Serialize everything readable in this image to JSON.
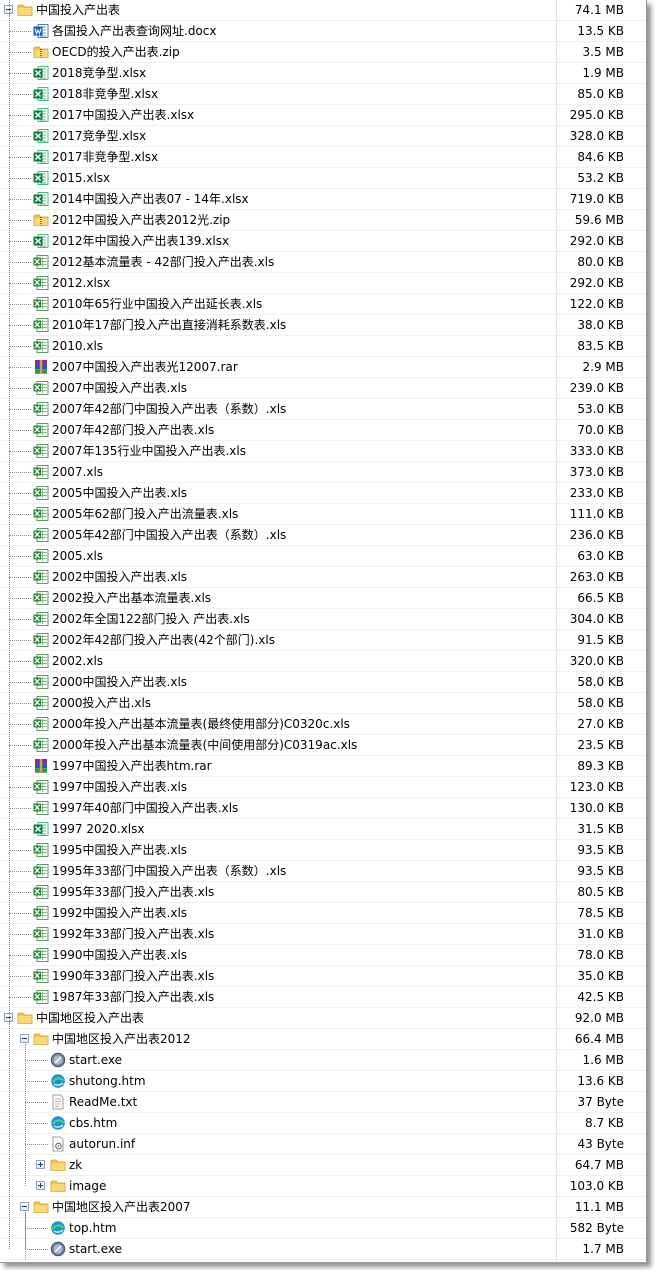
{
  "rows": [
    {
      "name": "中国投入产出表",
      "size": "74.1 MB",
      "type": "folder",
      "level": 0,
      "toggle": "minus"
    },
    {
      "name": "各国投入产出表查询网址.docx",
      "size": "13.5 KB",
      "type": "docx-icon",
      "level": 1
    },
    {
      "name": "OECD的投入产出表.zip",
      "size": "3.5 MB",
      "type": "zip-icon",
      "level": 1
    },
    {
      "name": "2018竞争型.xlsx",
      "size": "1.9 MB",
      "type": "xlsx-icon",
      "level": 1
    },
    {
      "name": "2018非竞争型.xlsx",
      "size": "85.0 KB",
      "type": "xlsx-icon",
      "level": 1
    },
    {
      "name": "2017中国投入产出表.xlsx",
      "size": "295.0 KB",
      "type": "xlsx-icon",
      "level": 1
    },
    {
      "name": "2017竞争型.xlsx",
      "size": "328.0 KB",
      "type": "xlsx-icon",
      "level": 1
    },
    {
      "name": "2017非竞争型.xlsx",
      "size": "84.6 KB",
      "type": "xlsx-icon",
      "level": 1
    },
    {
      "name": "2015.xlsx",
      "size": "53.2 KB",
      "type": "xlsx-icon",
      "level": 1
    },
    {
      "name": "2014中国投入产出表07 - 14年.xlsx",
      "size": "719.0 KB",
      "type": "xlsx-icon",
      "level": 1
    },
    {
      "name": "2012中国投入产出表2012光.zip",
      "size": "59.6 MB",
      "type": "zip-icon",
      "level": 1
    },
    {
      "name": "2012年中国投入产出表139.xlsx",
      "size": "292.0 KB",
      "type": "xlsx-icon",
      "level": 1
    },
    {
      "name": "2012基本流量表 - 42部门投入产出表.xls",
      "size": "80.0 KB",
      "type": "xls-icon",
      "level": 1
    },
    {
      "name": "2012.xlsx",
      "size": "292.0 KB",
      "type": "xls-icon",
      "level": 1
    },
    {
      "name": "2010年65行业中国投入产出延长表.xls",
      "size": "122.0 KB",
      "type": "xls-icon",
      "level": 1
    },
    {
      "name": "2010年17部门投入产出直接消耗系数表.xls",
      "size": "38.0 KB",
      "type": "xls-icon",
      "level": 1
    },
    {
      "name": "2010.xls",
      "size": "83.5 KB",
      "type": "xls-icon",
      "level": 1
    },
    {
      "name": "2007中国投入产出表光12007.rar",
      "size": "2.9 MB",
      "type": "rar-icon",
      "level": 1
    },
    {
      "name": "2007中国投入产出表.xls",
      "size": "239.0 KB",
      "type": "xls-icon",
      "level": 1
    },
    {
      "name": "2007年42部门中国投入产出表（系数）.xls",
      "size": "53.0 KB",
      "type": "xls-icon",
      "level": 1
    },
    {
      "name": "2007年42部门投入产出表.xls",
      "size": "70.0 KB",
      "type": "xls-icon",
      "level": 1
    },
    {
      "name": "2007年135行业中国投入产出表.xls",
      "size": "333.0 KB",
      "type": "xls-icon",
      "level": 1
    },
    {
      "name": "2007.xls",
      "size": "373.0 KB",
      "type": "xls-icon",
      "level": 1
    },
    {
      "name": "2005中国投入产出表.xls",
      "size": "233.0 KB",
      "type": "xls-icon",
      "level": 1
    },
    {
      "name": "2005年62部门投入产出流量表.xls",
      "size": "111.0 KB",
      "type": "xls-icon",
      "level": 1
    },
    {
      "name": "2005年42部门中国投入产出表（系数）.xls",
      "size": "236.0 KB",
      "type": "xls-icon",
      "level": 1
    },
    {
      "name": "2005.xls",
      "size": "63.0 KB",
      "type": "xls-icon",
      "level": 1
    },
    {
      "name": "2002中国投入产出表.xls",
      "size": "263.0 KB",
      "type": "xls-icon",
      "level": 1
    },
    {
      "name": "2002投入产出基本流量表.xls",
      "size": "66.5 KB",
      "type": "xls-icon",
      "level": 1
    },
    {
      "name": "2002年全国122部门投入 产出表.xls",
      "size": "304.0 KB",
      "type": "xls-icon",
      "level": 1
    },
    {
      "name": "2002年42部门投入产出表(42个部门).xls",
      "size": "91.5 KB",
      "type": "xls-icon",
      "level": 1
    },
    {
      "name": "2002.xls",
      "size": "320.0 KB",
      "type": "xls-icon",
      "level": 1
    },
    {
      "name": "2000中国投入产出表.xls",
      "size": "58.0 KB",
      "type": "xls-icon",
      "level": 1
    },
    {
      "name": "2000投入产出.xls",
      "size": "58.0 KB",
      "type": "xls-icon",
      "level": 1
    },
    {
      "name": "2000年投入产出基本流量表(最终使用部分)C0320c.xls",
      "size": "27.0 KB",
      "type": "xls-icon",
      "level": 1
    },
    {
      "name": "2000年投入产出基本流量表(中间使用部分)C0319ac.xls",
      "size": "23.5 KB",
      "type": "xls-icon",
      "level": 1
    },
    {
      "name": "1997中国投入产出表htm.rar",
      "size": "89.3 KB",
      "type": "rar-icon",
      "level": 1
    },
    {
      "name": "1997中国投入产出表.xls",
      "size": "123.0 KB",
      "type": "xls-icon",
      "level": 1
    },
    {
      "name": "1997年40部门中国投入产出表.xls",
      "size": "130.0 KB",
      "type": "xls-icon",
      "level": 1
    },
    {
      "name": "1997 2020.xlsx",
      "size": "31.5 KB",
      "type": "xlsx-icon",
      "level": 1
    },
    {
      "name": "1995中国投入产出表.xls",
      "size": "93.5 KB",
      "type": "xls-icon",
      "level": 1
    },
    {
      "name": "1995年33部门中国投入产出表（系数）.xls",
      "size": "93.5 KB",
      "type": "xls-icon",
      "level": 1
    },
    {
      "name": "1995年33部门投入产出表.xls",
      "size": "80.5 KB",
      "type": "xls-icon",
      "level": 1
    },
    {
      "name": "1992中国投入产出表.xls",
      "size": "78.5 KB",
      "type": "xls-icon",
      "level": 1
    },
    {
      "name": "1992年33部门投入产出表.xls",
      "size": "31.0 KB",
      "type": "xls-icon",
      "level": 1
    },
    {
      "name": "1990中国投入产出表.xls",
      "size": "78.0 KB",
      "type": "xls-icon",
      "level": 1
    },
    {
      "name": "1990年33部门投入产出表.xls",
      "size": "35.0 KB",
      "type": "xls-icon",
      "level": 1
    },
    {
      "name": "1987年33部门投入产出表.xls",
      "size": "42.5 KB",
      "type": "xls-icon",
      "level": 1
    },
    {
      "name": "中国地区投入产出表",
      "size": "92.0 MB",
      "type": "folder",
      "level": 0,
      "toggle": "minus"
    },
    {
      "name": "中国地区投入产出表2012",
      "size": "66.4 MB",
      "type": "folder",
      "level": 1,
      "toggle": "minus"
    },
    {
      "name": "start.exe",
      "size": "1.6 MB",
      "type": "exe-icon",
      "level": 2
    },
    {
      "name": "shutong.htm",
      "size": "13.6 KB",
      "type": "htm-icon",
      "level": 2
    },
    {
      "name": "ReadMe.txt",
      "size": "37 Byte",
      "type": "txt-icon",
      "level": 2
    },
    {
      "name": "cbs.htm",
      "size": "8.7 KB",
      "type": "htm-icon",
      "level": 2
    },
    {
      "name": "autorun.inf",
      "size": "43 Byte",
      "type": "inf-icon",
      "level": 2
    },
    {
      "name": "zk",
      "size": "64.7 MB",
      "type": "folder",
      "level": 2,
      "toggle": "plus"
    },
    {
      "name": "image",
      "size": "103.0 KB",
      "type": "folder",
      "level": 2,
      "toggle": "plus"
    },
    {
      "name": "中国地区投入产出表2007",
      "size": "11.1 MB",
      "type": "folder",
      "level": 1,
      "toggle": "minus"
    },
    {
      "name": "top.htm",
      "size": "582 Byte",
      "type": "htm-icon",
      "level": 2
    },
    {
      "name": "start.exe",
      "size": "1.7 MB",
      "type": "exe-icon",
      "level": 2
    }
  ]
}
